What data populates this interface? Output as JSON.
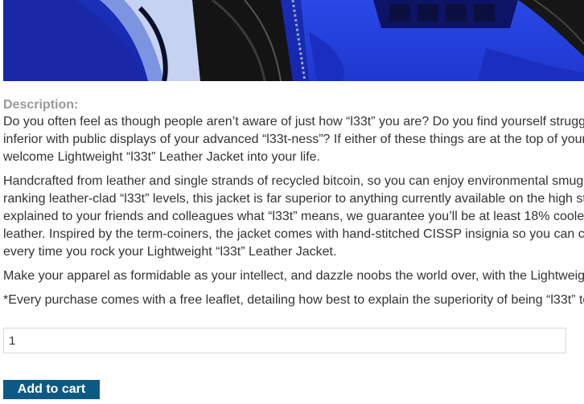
{
  "product": {
    "image_name": "product-image",
    "description_label": "Description:",
    "paragraphs": [
      {
        "lines": [
          "Do you often feel as though people aren’t aware of just how “l33t” you are? Do you find yourself strugg",
          "inferior with public displays of your advanced “l33t-ness”? If either of these things are at the top of your",
          "welcome Lightweight “l33t” Leather Jacket into your life."
        ]
      },
      {
        "lines": [
          "Handcrafted from leather and single strands of recycled bitcoin, so you can enjoy environmental smug",
          "ranking leather-clad “l33t” levels, this jacket is far superior to anything currently available on the high st",
          "explained to your friends and colleagues what “l33t” means, we guarantee you’ll be at least 18% coole",
          "leather. Inspired by the term-coiners, the jacket comes with hand-stitched CISSP insignia so you can c",
          "every time you rock your Lightweight “l33t” Leather Jacket."
        ]
      },
      {
        "lines": [
          "Make your apparel as formidable as your intellect, and dazzle noobs the world over, with the Lightweig"
        ]
      },
      {
        "lines": [
          "*Every purchase comes with a free leaflet, detailing how best to explain the superiority of being “l33t” to"
        ]
      }
    ]
  },
  "cart": {
    "quantity_value": "1",
    "add_button_label": "Add to cart"
  },
  "colors": {
    "button_bg": "#0c5a83",
    "label_gray": "#999999",
    "body_text": "#333333"
  }
}
